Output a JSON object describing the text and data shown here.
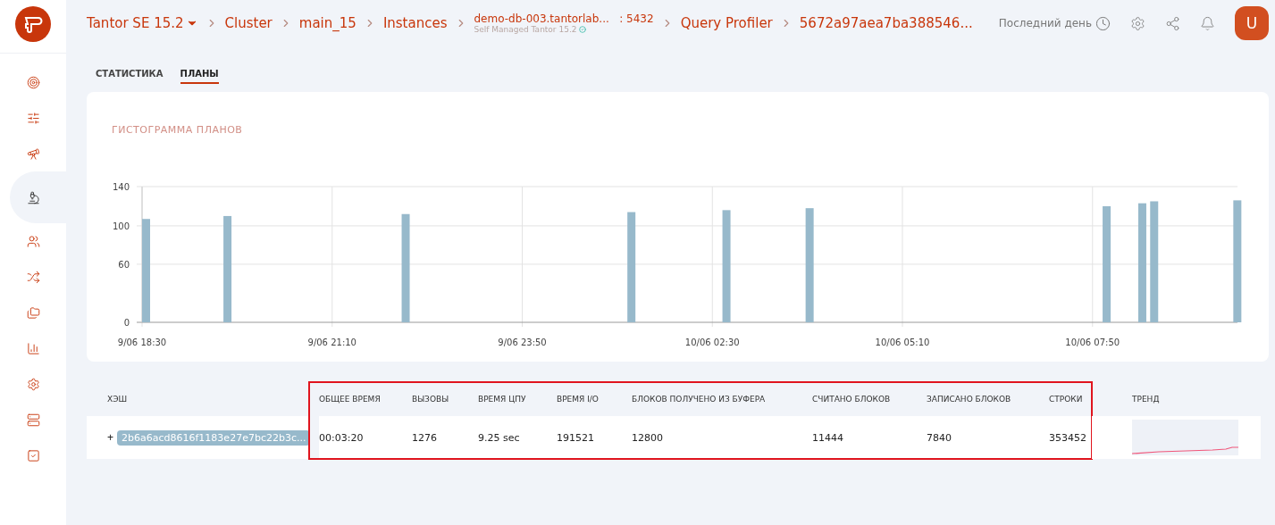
{
  "sidebar": {
    "items": [
      {
        "selected": false
      },
      {
        "selected": false
      },
      {
        "selected": false
      },
      {
        "selected": true
      },
      {
        "selected": false
      },
      {
        "selected": false
      },
      {
        "selected": false
      },
      {
        "selected": false
      },
      {
        "selected": false
      },
      {
        "selected": false
      },
      {
        "selected": false
      }
    ]
  },
  "breadcrumbs": [
    {
      "kind": "dropdown",
      "label": "Tantor SE 15.2"
    },
    {
      "kind": "link",
      "label": "Cluster"
    },
    {
      "kind": "link",
      "label": "main_15"
    },
    {
      "kind": "link",
      "label": "Instances"
    },
    {
      "kind": "instance",
      "label": "demo-db-003.tantorlab...",
      "port": ": 5432",
      "subtitle": "Self Managed Tantor 15.2"
    },
    {
      "kind": "link",
      "label": "Query Profiler"
    },
    {
      "kind": "link",
      "label": "5672a97aea7ba388546..."
    }
  ],
  "header": {
    "period": "Последний день",
    "avatar": "U"
  },
  "tabs": [
    {
      "label": "СТАТИСТИКА",
      "selected": false
    },
    {
      "label": "ПЛАНЫ",
      "selected": true
    }
  ],
  "histogram": {
    "title": "ГИСТОГРАММА ПЛАНОВ",
    "chart_data": {
      "type": "bar",
      "categories": [
        "9/06 18:30",
        null,
        null,
        null,
        null,
        null,
        null,
        null,
        null,
        null,
        null,
        null,
        null,
        null,
        null,
        null,
        "9/06 21:10",
        null,
        null,
        null,
        null,
        null,
        null,
        null,
        null,
        null,
        null,
        null,
        null,
        null,
        null,
        null,
        "9/06 23:50",
        null,
        null,
        null,
        null,
        null,
        null,
        null,
        null,
        null,
        null,
        null,
        null,
        null,
        null,
        null,
        "10/06 02:30",
        null,
        null,
        null,
        null,
        null,
        null,
        null,
        null,
        null,
        null,
        null,
        null,
        null,
        null,
        null,
        "10/06 05:10",
        null,
        null,
        null,
        null,
        null,
        null,
        null,
        null,
        null,
        null,
        null,
        null,
        null,
        null,
        null,
        "10/06 07:50",
        null,
        null,
        null,
        null,
        null,
        null,
        null,
        null,
        null,
        null,
        null,
        null
      ],
      "values": [
        107,
        null,
        null,
        null,
        null,
        null,
        null,
        110,
        null,
        null,
        null,
        null,
        null,
        null,
        null,
        null,
        null,
        null,
        null,
        null,
        null,
        null,
        112,
        null,
        null,
        null,
        null,
        null,
        null,
        null,
        null,
        null,
        null,
        null,
        null,
        null,
        null,
        null,
        null,
        null,
        null,
        114,
        null,
        null,
        null,
        null,
        null,
        null,
        null,
        116,
        null,
        null,
        null,
        null,
        null,
        null,
        118,
        null,
        null,
        null,
        null,
        null,
        null,
        null,
        null,
        null,
        null,
        null,
        null,
        null,
        null,
        null,
        null,
        null,
        null,
        null,
        null,
        null,
        null,
        null,
        null,
        120,
        null,
        null,
        123,
        125,
        null,
        null,
        null,
        null,
        null,
        null,
        126
      ],
      "ylim": [
        0,
        140
      ],
      "yticks": [
        0,
        60,
        100,
        140
      ],
      "grid": true
    }
  },
  "table": {
    "hash_column": "ХЭШ",
    "trend_column": "ТРЕНД",
    "highlighted": true,
    "metric_columns": [
      "ОБЩЕЕ ВРЕМЯ",
      "ВЫЗОВЫ",
      "ВРЕМЯ ЦПУ",
      "ВРЕМЯ I/O",
      "БЛОКОВ ПОЛУЧЕНО ИЗ БУФЕРА",
      "СЧИТАНО БЛОКОВ",
      "ЗАПИСАНО БЛОКОВ",
      "СТРОКИ"
    ],
    "rows": [
      {
        "expand": "+",
        "hash": "2b6a6acd8616f1183e27e7bc22b3c...",
        "metrics": [
          "00:03:20",
          "1276",
          "9.25 sec",
          "191521",
          "12800",
          "11444",
          "7840",
          "353452"
        ]
      }
    ]
  }
}
